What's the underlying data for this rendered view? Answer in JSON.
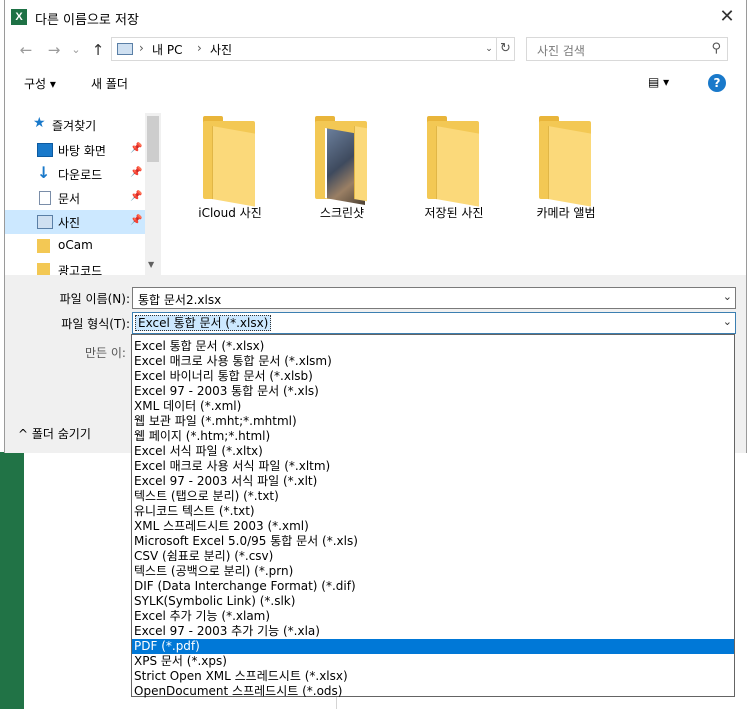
{
  "dialog": {
    "title": "다른 이름으로 저장",
    "close_glyph": "✕",
    "app_icon_letter": "X"
  },
  "nav": {
    "back_glyph": "←",
    "forward_glyph": "→",
    "recent_glyph": "⌄",
    "up_glyph": "↑",
    "breadcrumb": [
      "내 PC",
      "사진"
    ],
    "sep": "›",
    "refresh_glyph": "↻",
    "search_placeholder": "사진 검색",
    "search_glyph": "⚲"
  },
  "toolbar": {
    "organize_label": "구성 ▾",
    "new_folder_label": "새 폴더",
    "view_glyph": "▤ ▾",
    "help_glyph": "?"
  },
  "sidebar": {
    "items": [
      {
        "label": "즐겨찾기",
        "icon": "star-icon",
        "pinned": false,
        "selected": false
      },
      {
        "label": "바탕 화면",
        "icon": "desktop-icon",
        "pinned": true,
        "selected": false
      },
      {
        "label": "다운로드",
        "icon": "download-icon",
        "pinned": true,
        "selected": false
      },
      {
        "label": "문서",
        "icon": "document-icon",
        "pinned": true,
        "selected": false
      },
      {
        "label": "사진",
        "icon": "pictures-icon",
        "pinned": true,
        "selected": true
      },
      {
        "label": "oCam",
        "icon": "folder-icon",
        "pinned": false,
        "selected": false
      },
      {
        "label": "광고코드",
        "icon": "folder-icon",
        "pinned": false,
        "selected": false
      }
    ],
    "pin_glyph": "📌",
    "scroll_down_glyph": "▼"
  },
  "folders": [
    {
      "label": "iCloud 사진",
      "has_photo": false
    },
    {
      "label": "스크린샷",
      "has_photo": true
    },
    {
      "label": "저장된 사진",
      "has_photo": false
    },
    {
      "label": "카메라 앨범",
      "has_photo": false
    }
  ],
  "form": {
    "filename_label": "파일 이름(N):",
    "filename_value": "통합 문서2.xlsx",
    "filetype_label": "파일 형식(T):",
    "filetype_value": "Excel 통합 문서 (*.xlsx)",
    "authors_label": "만든 이:",
    "dropdown_glyph": "⌄",
    "hide_folders_label": "^ 폴더 숨기기"
  },
  "file_types": [
    "Excel 통합 문서 (*.xlsx)",
    "Excel 매크로 사용 통합 문서 (*.xlsm)",
    "Excel 바이너리 통합 문서 (*.xlsb)",
    "Excel 97 - 2003 통합 문서 (*.xls)",
    "XML 데이터 (*.xml)",
    "웹 보관 파일 (*.mht;*.mhtml)",
    "웹 페이지 (*.htm;*.html)",
    "Excel 서식 파일 (*.xltx)",
    "Excel 매크로 사용 서식 파일 (*.xltm)",
    "Excel 97 - 2003 서식 파일 (*.xlt)",
    "텍스트 (탭으로 분리) (*.txt)",
    "유니코드 텍스트 (*.txt)",
    "XML 스프레드시트 2003 (*.xml)",
    "Microsoft Excel 5.0/95 통합 문서 (*.xls)",
    "CSV (쉼표로 분리) (*.csv)",
    "텍스트 (공백으로 분리) (*.prn)",
    "DIF (Data Interchange Format) (*.dif)",
    "SYLK(Symbolic Link) (*.slk)",
    "Excel 추가 기능 (*.xlam)",
    "Excel 97 - 2003 추가 기능 (*.xla)",
    "PDF (*.pdf)",
    "XPS 문서 (*.xps)",
    "Strict Open XML 스프레드시트 (*.xlsx)",
    "OpenDocument 스프레드시트 (*.ods)"
  ],
  "file_types_selected": "PDF (*.pdf)",
  "colors": {
    "accent": "#0078d7",
    "excel_green": "#217346",
    "selection_light": "#cce8ff",
    "folder_yellow": "#f3c854"
  }
}
